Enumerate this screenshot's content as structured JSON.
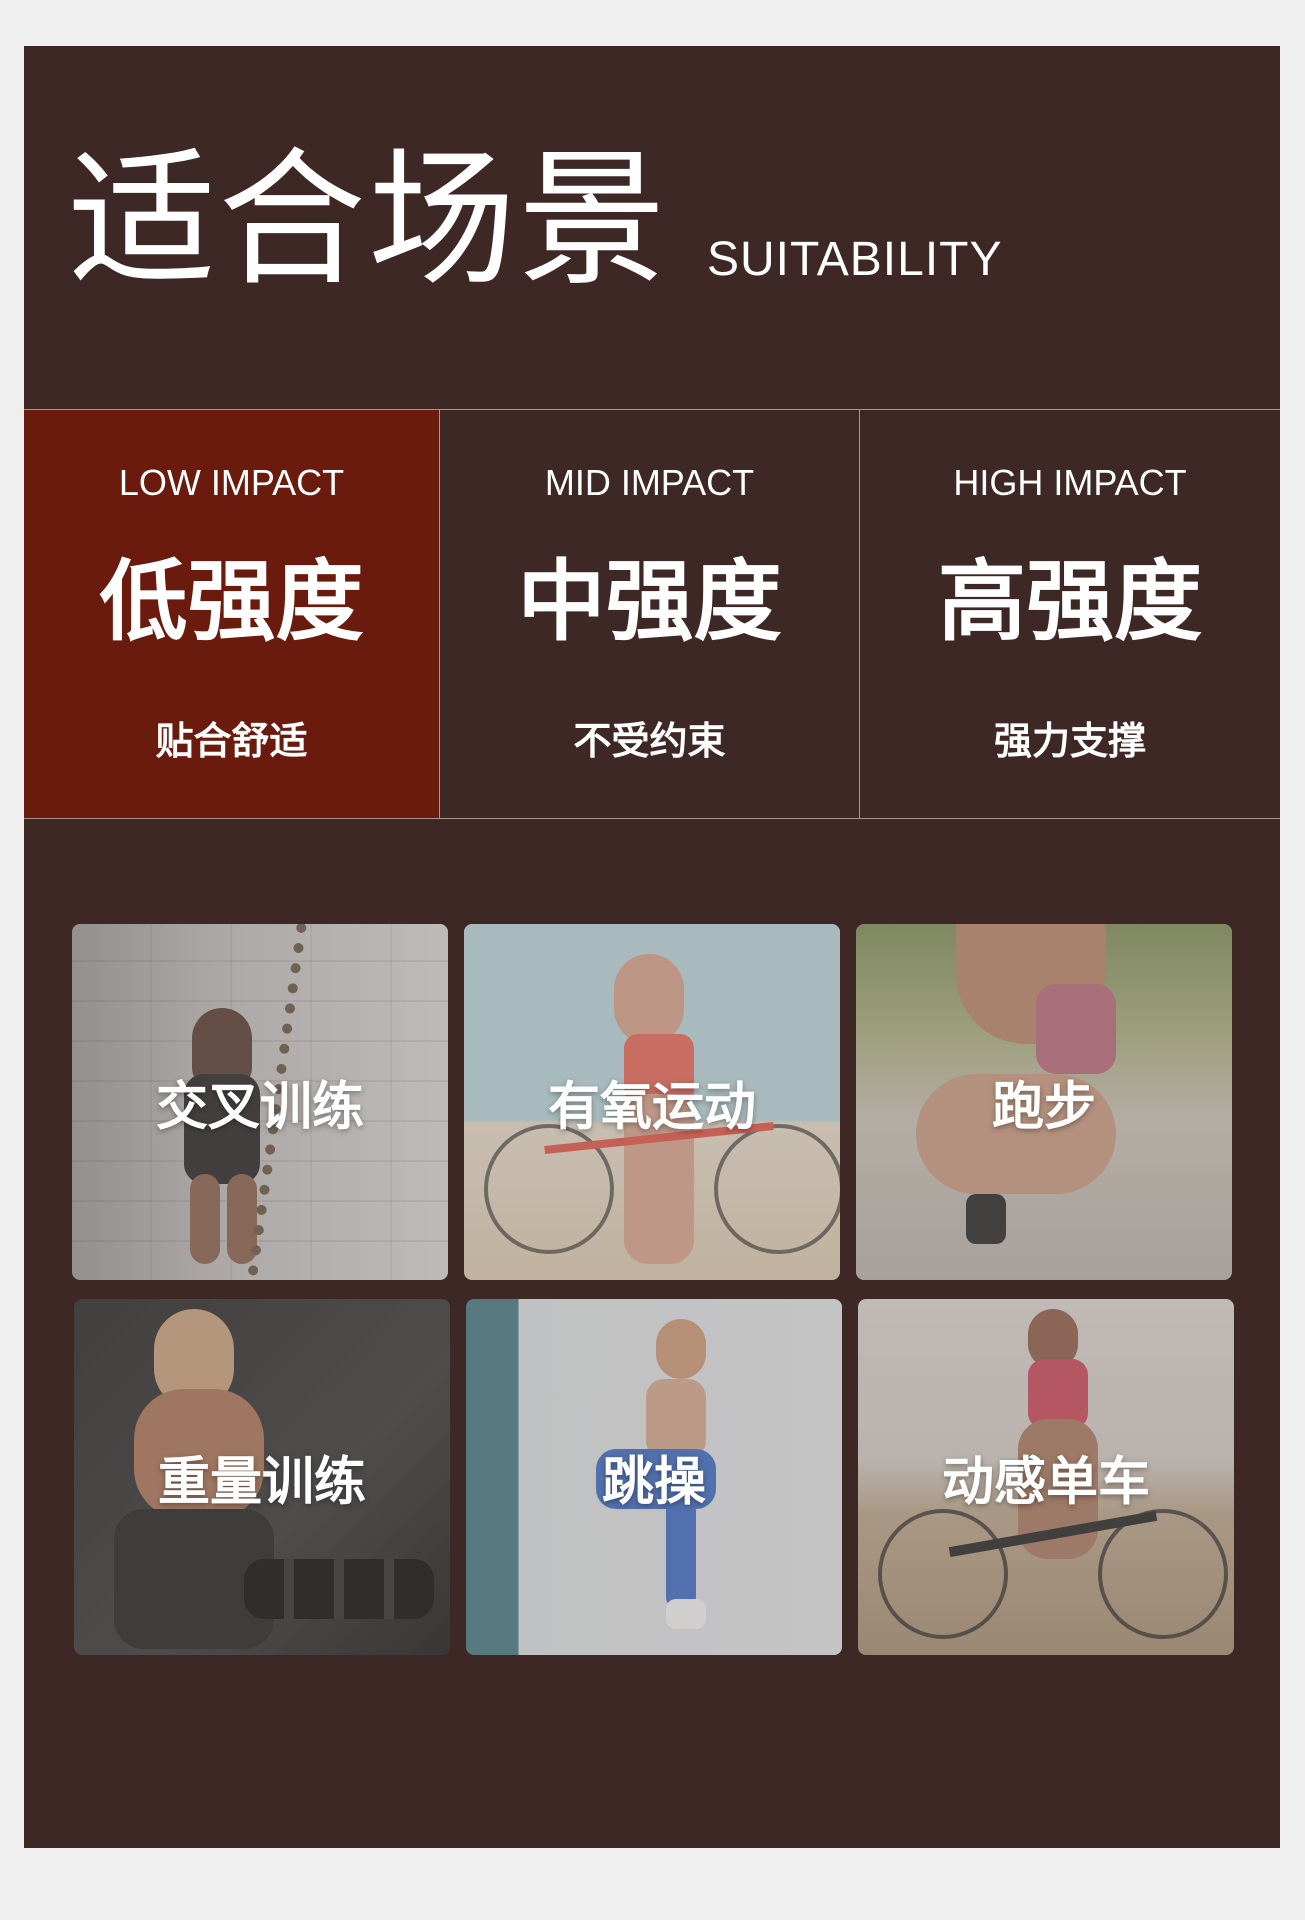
{
  "header": {
    "title_zh": "适合场景",
    "title_en": "SUITABILITY"
  },
  "intensity": [
    {
      "en": "LOW IMPACT",
      "zh": "低强度",
      "desc": "贴合舒适",
      "active": true
    },
    {
      "en": "MID IMPACT",
      "zh": "中强度",
      "desc": "不受约束",
      "active": false
    },
    {
      "en": "HIGH IMPACT",
      "zh": "高强度",
      "desc": "强力支撑",
      "active": false
    }
  ],
  "activities": [
    {
      "label": "交叉训练",
      "image": "woman-battle-ropes-photo"
    },
    {
      "label": "有氧运动",
      "image": "woman-drinking-with-bicycle-photo"
    },
    {
      "label": "跑步",
      "image": "woman-runner-start-pose-photo"
    },
    {
      "label": "重量训练",
      "image": "woman-dumbbells-gym-photo"
    },
    {
      "label": "跳操",
      "image": "woman-jumping-exercise-photo"
    },
    {
      "label": "动感单车",
      "image": "woman-mountain-bike-beach-photo"
    }
  ],
  "colors": {
    "panel_bg": "#3d2825",
    "active_col_bg": "#6b1b0d",
    "page_bg": "#efefef",
    "text": "#ffffff"
  }
}
